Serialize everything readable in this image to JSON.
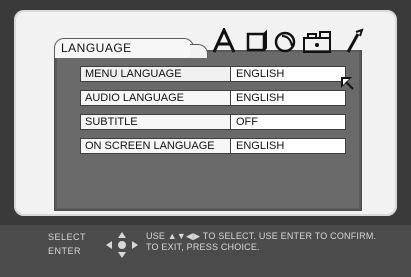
{
  "menu": {
    "tab_label": "LANGUAGE",
    "rows": [
      {
        "label": "MENU LANGUAGE",
        "value": "ENGLISH"
      },
      {
        "label": "AUDIO LANGUAGE",
        "value": "ENGLISH"
      },
      {
        "label": "SUBTITLE",
        "value": "OFF"
      },
      {
        "label": "ON SCREEN LANGUAGE",
        "value": "ENGLISH"
      }
    ]
  },
  "tabs_icons": [
    "language-icon",
    "picture-icon",
    "audio-icon",
    "parental-icon",
    "setup-icon"
  ],
  "footer": {
    "select_label": "SELECT",
    "enter_label": "ENTER",
    "instruction_line1": "USE ▲▼◀▶ TO SELECT.  USE ENTER TO CONFIRM.",
    "instruction_line2": "TO EXIT, PRESS CHOICE."
  },
  "colors": {
    "screen_bg": "#3a3a3a",
    "frame_bg": "#f2f2f2",
    "panel_bg": "#6a6a6a",
    "field_bg": "#ffffff"
  }
}
